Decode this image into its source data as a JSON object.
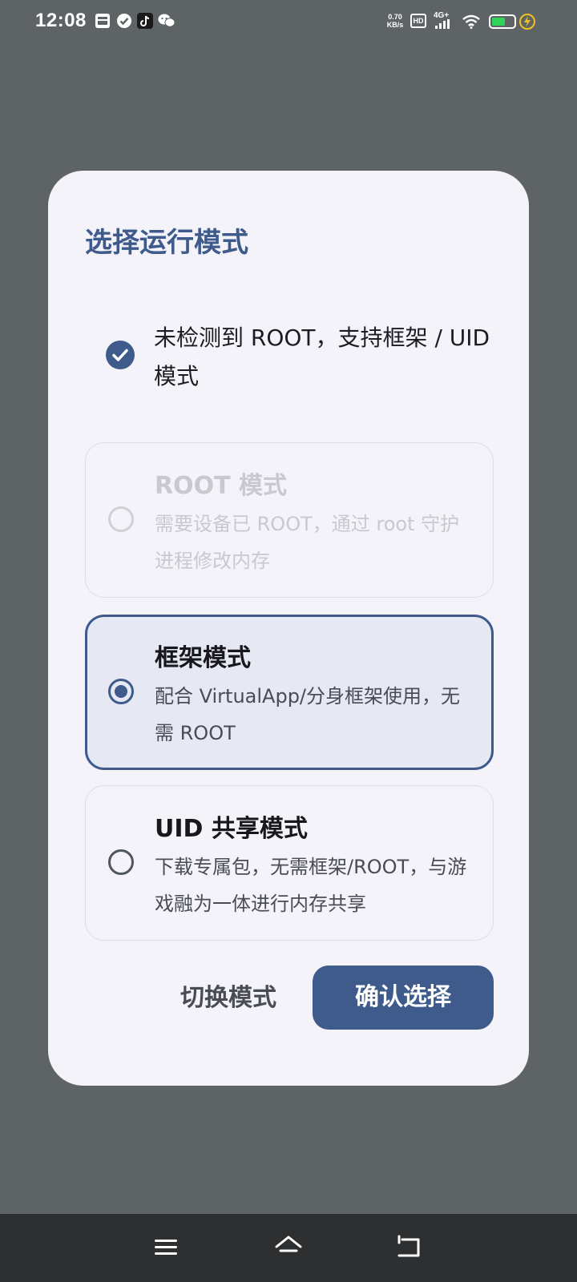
{
  "status_bar": {
    "time": "12:08",
    "net_speed_value": "0.70",
    "net_speed_unit": "KB/s",
    "hd_label": "HD",
    "signal_label": "4G+",
    "battery_level": 0.6,
    "icons": [
      "gallery-icon",
      "check-badge-icon",
      "tiktok-icon",
      "wechat-icon",
      "wifi-icon",
      "charging-icon"
    ]
  },
  "dialog": {
    "title": "选择运行模式",
    "detection_text": "未检测到 ROOT，支持框架 / UID 模式",
    "options": [
      {
        "title": "ROOT 模式",
        "description": "需要设备已 ROOT，通过 root 守护进程修改内存",
        "state": "disabled",
        "selected": false
      },
      {
        "title": "框架模式",
        "description": "配合 VirtualApp/分身框架使用，无需 ROOT",
        "state": "enabled",
        "selected": true
      },
      {
        "title": "UID 共享模式",
        "description": "下载专属包，无需框架/ROOT，与游戏融为一体进行内存共享",
        "state": "enabled",
        "selected": false
      }
    ],
    "switch_label": "切换模式",
    "confirm_label": "确认选择"
  },
  "nav_bar": {
    "icons": [
      "menu-icon",
      "home-icon",
      "back-icon"
    ]
  },
  "colors": {
    "accent": "#3e5b8c",
    "dialog_bg": "#f3f3f9",
    "scrim": "#5e6466",
    "nav_bg": "#2e2f31"
  }
}
